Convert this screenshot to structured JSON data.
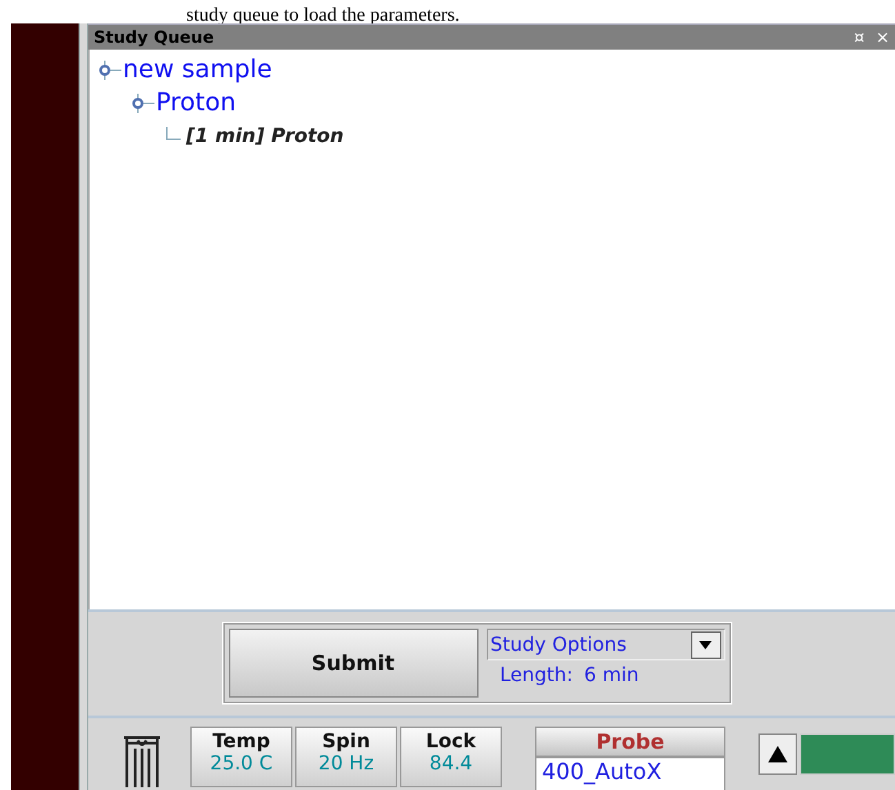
{
  "document_text": "study queue to load the parameters.",
  "panel": {
    "title": "Study Queue",
    "pin": "¤",
    "close": "×"
  },
  "tree": [
    {
      "label": "new sample",
      "expanded": true,
      "children": [
        {
          "label": "Proton",
          "expanded": true,
          "children": [
            {
              "label": "[1 min] Proton"
            }
          ]
        }
      ]
    }
  ],
  "submit": {
    "label": "Submit"
  },
  "study_options": {
    "value": "Study Options",
    "length_label": "Length:",
    "length_value": "6 min"
  },
  "status": [
    {
      "label": "Temp",
      "value": "25.0 C"
    },
    {
      "label": "Spin",
      "value": "20 Hz"
    },
    {
      "label": "Lock",
      "value": "84.4"
    }
  ],
  "probe": {
    "label": "Probe",
    "value": "400_AutoX"
  }
}
